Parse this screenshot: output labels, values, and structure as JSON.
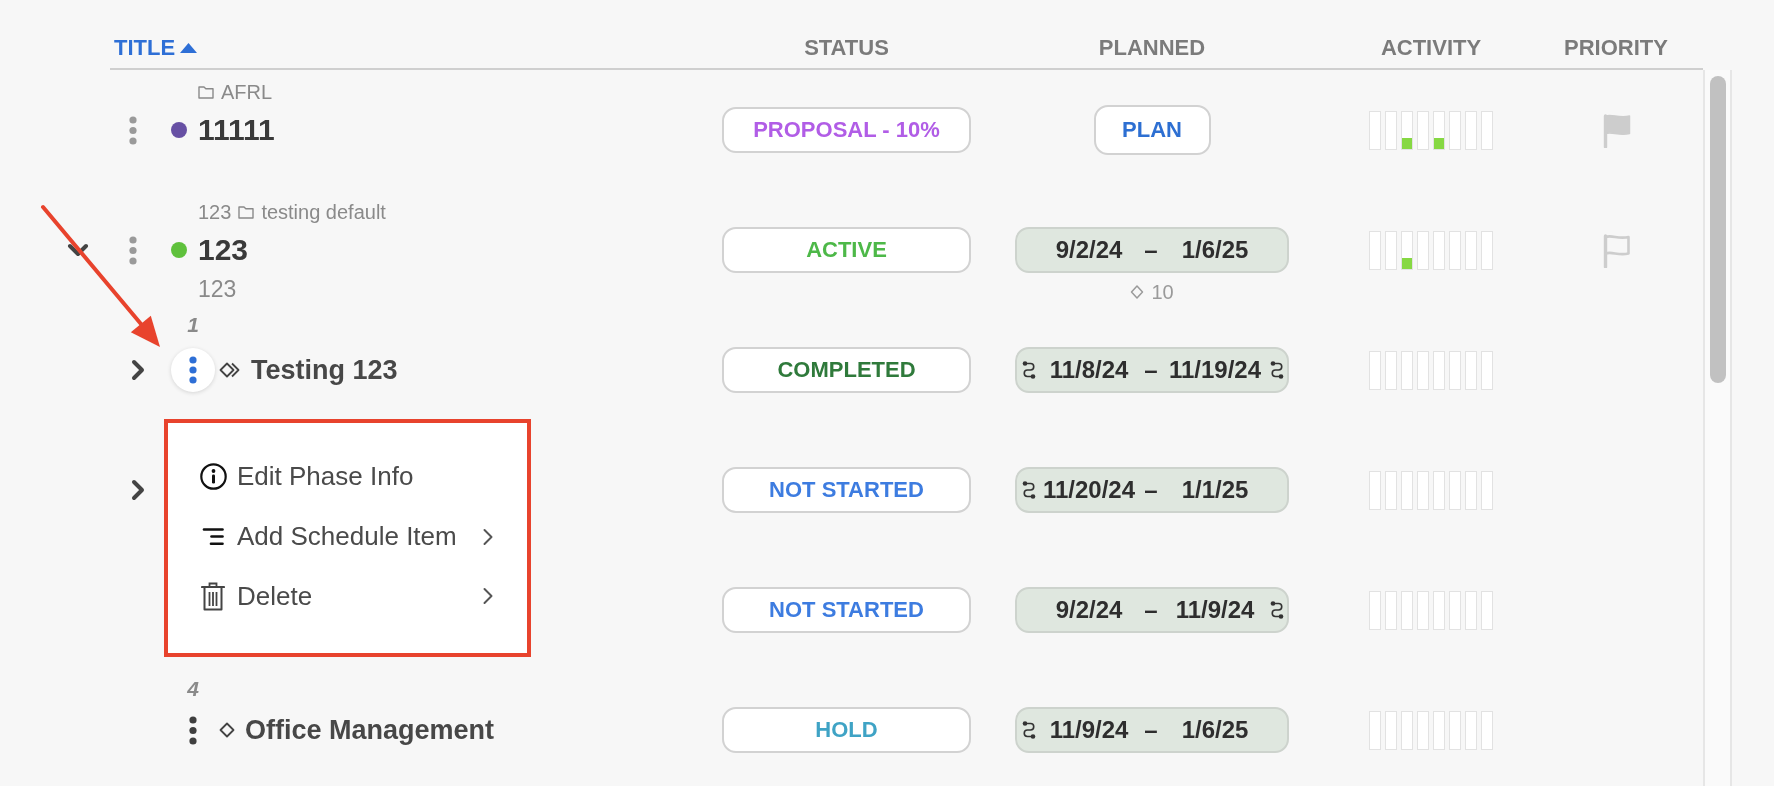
{
  "columns": [
    {
      "label": "TITLE",
      "selected": true,
      "ascending": true
    },
    {
      "label": "STATUS",
      "selected": false
    },
    {
      "label": "PLANNED",
      "selected": false
    },
    {
      "label": "ACTIVITY",
      "selected": false
    },
    {
      "label": "PRIORITY",
      "selected": false
    }
  ],
  "rows": [
    {
      "folder": "AFRL",
      "color": "#6750a4",
      "title": "11111",
      "menu_open": false,
      "status": {
        "label": "PROPOSAL - 10%",
        "color": "#b15de6"
      },
      "planned": {
        "kind": "button",
        "label": "PLAN"
      },
      "activity": [
        {
          "active": false
        },
        {
          "active": false
        },
        {
          "active": true
        },
        {
          "active": false
        },
        {
          "active": true
        },
        {
          "active": false
        },
        {
          "active": false
        },
        {
          "active": false
        }
      ],
      "flagged": true
    },
    {
      "expanded": true,
      "code": "123",
      "folder": "testing default",
      "color": "#5fc13c",
      "title": "123",
      "subtitle": "123",
      "menu_open": false,
      "status": {
        "label": "ACTIVE",
        "color": "#4db848"
      },
      "planned": {
        "kind": "range",
        "start": "9/2/24",
        "separator": "–",
        "end": "1/6/25",
        "start_marker": false,
        "end_marker": false,
        "count": "10"
      },
      "activity": [
        {
          "active": false
        },
        {
          "active": false
        },
        {
          "active": true
        },
        {
          "active": false
        },
        {
          "active": false
        },
        {
          "active": false
        },
        {
          "active": false
        },
        {
          "active": false
        }
      ],
      "flagged": false,
      "children": [
        {
          "expanded": false,
          "kind": "phase",
          "number": "1",
          "title": "Testing 123",
          "menu_open": true,
          "menu": {
            "highlighted": true,
            "items": [
              {
                "kind": "info",
                "label": "Edit Phase Info",
                "submenu": false
              },
              {
                "kind": "schedule",
                "label": "Add Schedule Item",
                "submenu": true
              },
              {
                "kind": "delete",
                "label": "Delete",
                "submenu": true
              }
            ]
          },
          "status": {
            "label": "COMPLETED",
            "color": "#2f7a3b"
          },
          "planned": {
            "kind": "range",
            "start": "11/8/24",
            "separator": "–",
            "end": "11/19/24",
            "start_marker": true,
            "end_marker": true
          },
          "activity": [
            {
              "active": false
            },
            {
              "active": false
            },
            {
              "active": false
            },
            {
              "active": false
            },
            {
              "active": false
            },
            {
              "active": false
            },
            {
              "active": false
            },
            {
              "active": false
            }
          ]
        },
        {
          "expanded": false,
          "status": {
            "label": "NOT STARTED",
            "color": "#3d7ce0"
          },
          "planned": {
            "kind": "range",
            "start": "11/20/24",
            "separator": "–",
            "end": "1/1/25",
            "start_marker": true,
            "end_marker": false
          },
          "activity": [
            {
              "active": false
            },
            {
              "active": false
            },
            {
              "active": false
            },
            {
              "active": false
            },
            {
              "active": false
            },
            {
              "active": false
            },
            {
              "active": false
            },
            {
              "active": false
            }
          ]
        },
        {
          "status": {
            "label": "NOT STARTED",
            "color": "#3d7ce0"
          },
          "planned": {
            "kind": "range",
            "start": "9/2/24",
            "separator": "–",
            "end": "11/9/24",
            "start_marker": false,
            "end_marker": true
          },
          "activity": [
            {
              "active": false
            },
            {
              "active": false
            },
            {
              "active": false
            },
            {
              "active": false
            },
            {
              "active": false
            },
            {
              "active": false
            },
            {
              "active": false
            },
            {
              "active": false
            }
          ]
        },
        {
          "kind": "milestone",
          "number": "4",
          "title": "Office Management",
          "menu_open": false,
          "status": {
            "label": "HOLD",
            "color": "#3fa3c5"
          },
          "planned": {
            "kind": "range",
            "start": "11/9/24",
            "separator": "–",
            "end": "1/6/25",
            "start_marker": true,
            "end_marker": false
          },
          "activity": [
            {
              "active": false
            },
            {
              "active": false
            },
            {
              "active": false
            },
            {
              "active": false
            },
            {
              "active": false
            },
            {
              "active": false
            },
            {
              "active": false
            },
            {
              "active": false
            }
          ]
        }
      ]
    }
  ],
  "annotations": [
    {
      "kind": "arrow"
    }
  ]
}
